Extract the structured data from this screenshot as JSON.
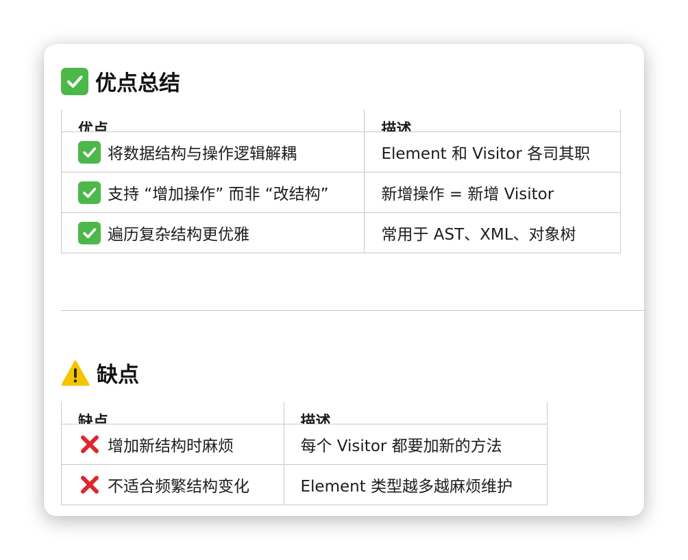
{
  "pros_section": {
    "icon": "check-mark-icon",
    "title": "优点总结",
    "headers": [
      "优点",
      "描述"
    ],
    "rows": [
      {
        "icon": "check-mark-icon",
        "advantage": "将数据结构与操作逻辑解耦",
        "description": "Element 和 Visitor 各司其职"
      },
      {
        "icon": "check-mark-icon",
        "advantage": "支持 “增加操作” 而非 “改结构”",
        "description": "新增操作 = 新增 Visitor"
      },
      {
        "icon": "check-mark-icon",
        "advantage": "遍历复杂结构更优雅",
        "description": "常用于 AST、XML、对象树"
      }
    ]
  },
  "cons_section": {
    "icon": "warning-icon",
    "title": "缺点",
    "headers": [
      "缺点",
      "描述"
    ],
    "rows": [
      {
        "icon": "cross-mark-icon",
        "disadvantage": "增加新结构时麻烦",
        "description": "每个 Visitor 都要加新的方法"
      },
      {
        "icon": "cross-mark-icon",
        "disadvantage": "不适合频繁结构变化",
        "description": "Element 类型越多越麻烦维护"
      }
    ]
  },
  "colors": {
    "check_green": "#4cb84a",
    "cross_red": "#e0262d",
    "warning_yellow": "#f5c400",
    "border": "#c9c9c9"
  }
}
